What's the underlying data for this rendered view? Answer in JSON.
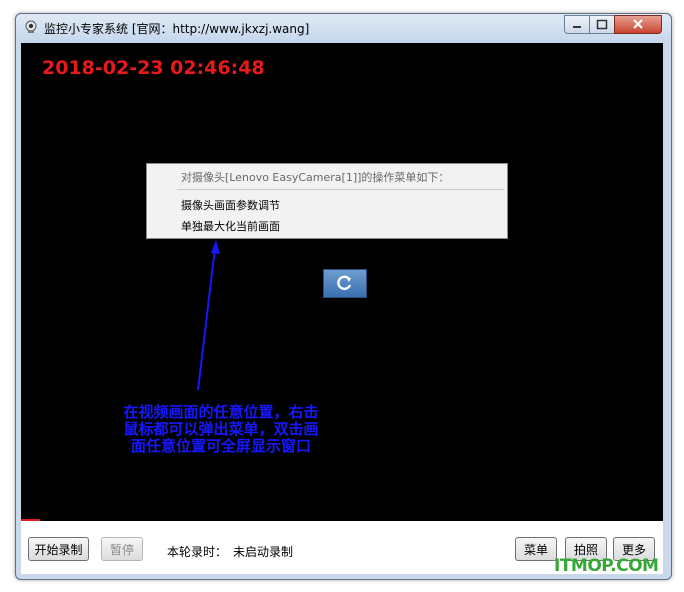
{
  "window": {
    "title": "监控小专家系统 [官网：http://www.jkxzj.wang]"
  },
  "video": {
    "timestamp": "2018-02-23 02:46:48"
  },
  "context_menu": {
    "header": "对摄像头[Lenovo EasyCamera[1]]的操作菜单如下：",
    "items": [
      "摄像头画面参数调节",
      "单独最大化当前画面"
    ]
  },
  "annotation": {
    "lines": [
      "在视频画面的任意位置，右击",
      "鼠标都可以弹出菜单，双击画",
      "面任意位置可全屏显示窗口"
    ]
  },
  "bottom": {
    "start_record": "开始录制",
    "pause": "暂停",
    "round_label": "本轮录时：",
    "round_value": "未启动录制",
    "menu": "菜单",
    "snapshot": "拍照",
    "more": "更多"
  },
  "watermark": "ITMOP.COM",
  "colors": {
    "timestamp": "#e8191b",
    "annotation": "#1717ff",
    "watermark": "#35a836"
  }
}
